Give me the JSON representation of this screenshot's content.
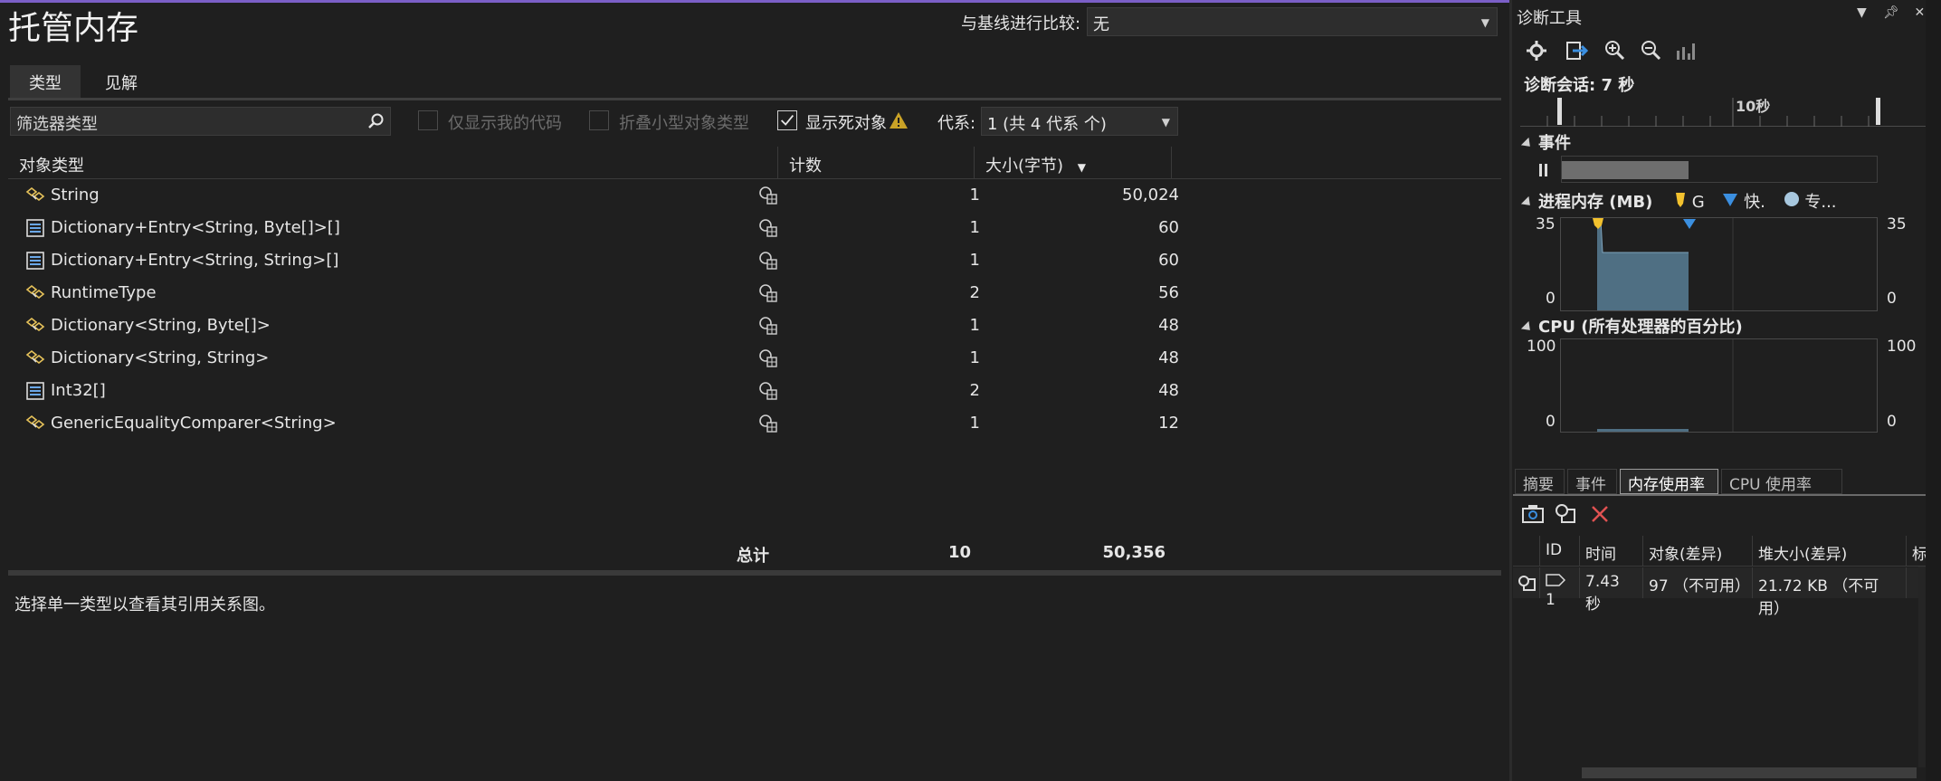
{
  "page": {
    "title": "托管内存",
    "compare_label": "与基线进行比较:",
    "compare_value": "无",
    "tabs": [
      {
        "label": "类型",
        "active": true
      },
      {
        "label": "见解",
        "active": false
      }
    ],
    "filter_placeholder": "筛选器类型",
    "checkboxes": [
      {
        "label": "仅显示我的代码",
        "checked": false,
        "enabled": false
      },
      {
        "label": "折叠小型对象类型",
        "checked": false,
        "enabled": false
      },
      {
        "label": "显示死对象",
        "checked": true,
        "enabled": true
      }
    ],
    "generation_label": "代系:",
    "generation_value": "1 (共 4 代系 个)",
    "columns": {
      "type": "对象类型",
      "count": "计数",
      "size": "大小(字节)"
    },
    "rows": [
      {
        "name": "String",
        "icon": "class-icon",
        "count": "1",
        "size": "50,024"
      },
      {
        "name": "Dictionary+Entry<String, Byte[]>[]",
        "icon": "array-icon",
        "count": "1",
        "size": "60"
      },
      {
        "name": "Dictionary+Entry<String, String>[]",
        "icon": "array-icon",
        "count": "1",
        "size": "60"
      },
      {
        "name": "RuntimeType",
        "icon": "class-icon",
        "count": "2",
        "size": "56"
      },
      {
        "name": "Dictionary<String, Byte[]>",
        "icon": "class-icon",
        "count": "1",
        "size": "48"
      },
      {
        "name": "Dictionary<String, String>",
        "icon": "class-icon",
        "count": "1",
        "size": "48"
      },
      {
        "name": "Int32[]",
        "icon": "array-icon",
        "count": "2",
        "size": "48"
      },
      {
        "name": "GenericEqualityComparer<String>",
        "icon": "class-icon",
        "count": "1",
        "size": "12"
      }
    ],
    "total": {
      "label": "总计",
      "count": "10",
      "size": "50,356"
    },
    "hint": "选择单一类型以查看其引用关系图。"
  },
  "diag": {
    "title": "诊断工具",
    "session": "诊断会话: 7 秒",
    "ruler_label": "10秒",
    "events_title": "事件",
    "memory_title": "进程内存 (MB)",
    "legend": [
      "G",
      "快.",
      "专..."
    ],
    "mem_axis": {
      "max": "35",
      "min": "0"
    },
    "cpu_title": "CPU (所有处理器的百分比)",
    "cpu_axis": {
      "max": "100",
      "min": "0"
    },
    "tabs": [
      {
        "label": "摘要",
        "active": false
      },
      {
        "label": "事件",
        "active": false
      },
      {
        "label": "内存使用率",
        "active": true
      },
      {
        "label": "CPU 使用率",
        "active": false
      }
    ],
    "snap_columns": [
      "ID",
      "时间",
      "对象(差异)",
      "堆大小(差异)",
      "标"
    ],
    "snap_row": {
      "id": "1",
      "time": "7.43 秒",
      "objects": "97 （不可用）",
      "heap": "21.72 KB （不可用）"
    }
  },
  "colors": {
    "accent": "#7b5fc7",
    "chart_fill": "#4f6f83",
    "legend_gc": "#f2c12e",
    "legend_snap": "#3b8fe0"
  }
}
